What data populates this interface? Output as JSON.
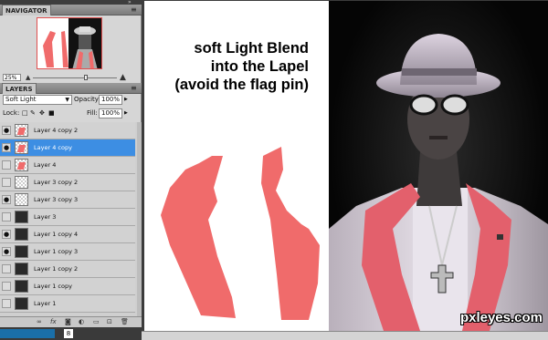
{
  "navigator": {
    "title": "NAVIGATOR",
    "zoom": "25%"
  },
  "layers_panel": {
    "title": "LAYERS",
    "blend_mode": "Soft Light",
    "opacity_label": "Opacity:",
    "opacity_value": "100%",
    "lock_label": "Lock:",
    "fill_label": "Fill:",
    "fill_value": "100%",
    "layers": [
      {
        "name": "Layer 4 copy 2",
        "visible": true,
        "selected": false,
        "thumb": "transparent-red"
      },
      {
        "name": "Layer 4 copy",
        "visible": true,
        "selected": true,
        "thumb": "transparent-red"
      },
      {
        "name": "Layer 4",
        "visible": false,
        "selected": false,
        "thumb": "transparent-red"
      },
      {
        "name": "Layer 3 copy 2",
        "visible": false,
        "selected": false,
        "thumb": "transparent"
      },
      {
        "name": "Layer 3 copy 3",
        "visible": true,
        "selected": false,
        "thumb": "transparent"
      },
      {
        "name": "Layer 3",
        "visible": false,
        "selected": false,
        "thumb": "photo"
      },
      {
        "name": "Layer 1 copy 4",
        "visible": true,
        "selected": false,
        "thumb": "photo"
      },
      {
        "name": "Layer 1 copy 3",
        "visible": true,
        "selected": false,
        "thumb": "photo"
      },
      {
        "name": "Layer 1 copy 2",
        "visible": false,
        "selected": false,
        "thumb": "photo"
      },
      {
        "name": "Layer 1 copy",
        "visible": false,
        "selected": false,
        "thumb": "photo"
      },
      {
        "name": "Layer 1",
        "visible": false,
        "selected": false,
        "thumb": "photo"
      }
    ]
  },
  "taskbar": {
    "item": "8"
  },
  "canvas": {
    "caption_lines": [
      "soft Light Blend",
      "into the Lapel",
      "(avoid the flag pin)"
    ],
    "watermark": "pxleyes.com"
  },
  "colors": {
    "selection": "#3d8ee3",
    "lapel": "#f06b6b"
  }
}
